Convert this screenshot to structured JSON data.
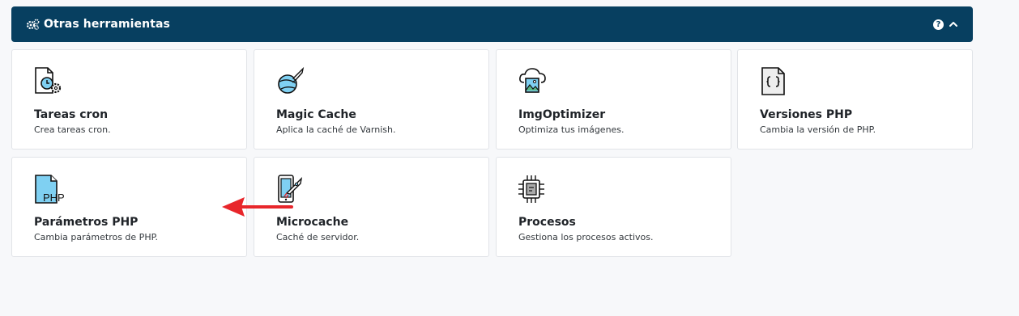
{
  "panel": {
    "title": "Otras herramientas",
    "help_label": "?"
  },
  "tools": [
    {
      "name": "Tareas cron",
      "description": "Crea tareas cron.",
      "icon": "clock-file-gear-icon"
    },
    {
      "name": "Magic Cache",
      "description": "Aplica la caché de Varnish.",
      "icon": "planet-rocket-icon"
    },
    {
      "name": "ImgOptimizer",
      "description": "Optimiza tus imágenes.",
      "icon": "cloud-image-icon"
    },
    {
      "name": "Versiones PHP",
      "description": "Cambia la versión de PHP.",
      "icon": "code-file-icon"
    },
    {
      "name": "Parámetros PHP",
      "description": "Cambia parámetros de PHP.",
      "icon": "php-file-icon",
      "icon_text": "PHP"
    },
    {
      "name": "Microcache",
      "description": "Caché de servidor.",
      "icon": "phone-rocket-icon"
    },
    {
      "name": "Procesos",
      "description": "Gestiona los procesos activos.",
      "icon": "cpu-chip-icon"
    }
  ],
  "annotation": {
    "icon": "red-arrow-icon",
    "color": "#e8262b"
  }
}
